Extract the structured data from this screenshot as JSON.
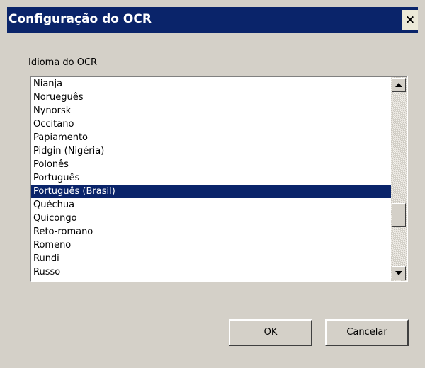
{
  "window": {
    "title": "Configuração do OCR",
    "close_glyph": "×",
    "close_icon": "close-icon"
  },
  "group": {
    "label": "Idioma do OCR"
  },
  "languages": {
    "items": [
      "Nianja",
      "Norueguês",
      "Nynorsk",
      "Occitano",
      "Papiamento",
      "Pidgin (Nigéria)",
      "Polonês",
      "Português",
      "Português (Brasil)",
      "Quéchua",
      "Quicongo",
      "Reto-romano",
      "Romeno",
      "Rundi",
      "Russo"
    ],
    "selected": "Português (Brasil)",
    "scroll_position_fraction": 0.62
  },
  "buttons": {
    "ok": "OK",
    "cancel": "Cancelar"
  },
  "colors": {
    "title_bar": "#0a246a",
    "selection": "#0a246a",
    "dialog_face": "#d4d0c8"
  }
}
